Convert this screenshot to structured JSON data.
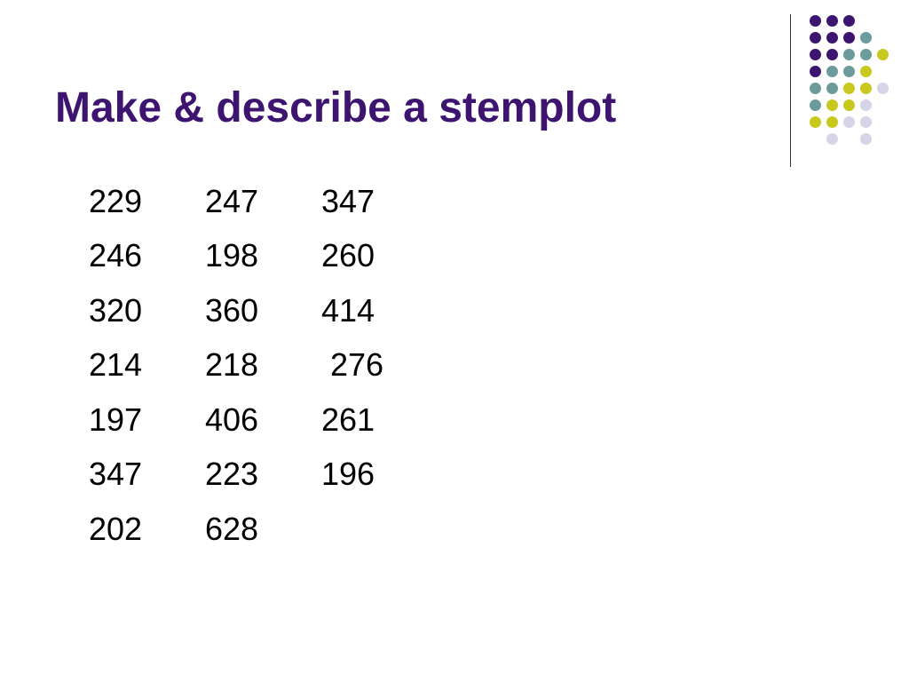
{
  "slide": {
    "title": "Make & describe a stemplot",
    "title_color": "#3d1470",
    "values": [
      [
        "229",
        "247",
        "347"
      ],
      [
        "246",
        "198",
        "260"
      ],
      [
        "320",
        "360",
        "414"
      ],
      [
        "214",
        "218",
        " 276"
      ],
      [
        "197",
        "406",
        "261"
      ],
      [
        "347",
        "223",
        "196"
      ],
      [
        "202",
        "628",
        ""
      ]
    ]
  },
  "decoration": {
    "colors": {
      "purple": "#3d1470",
      "teal": "#6b9b9b",
      "yellow": "#c8c81e",
      "lavender": "#d6d4e6"
    },
    "dots": [
      [
        "purple",
        "purple",
        "purple",
        null,
        null
      ],
      [
        "purple",
        "purple",
        "purple",
        "teal",
        null
      ],
      [
        "purple",
        "purple",
        "teal",
        "teal",
        "yellow"
      ],
      [
        "purple",
        "teal",
        "teal",
        "yellow",
        null
      ],
      [
        "teal",
        "teal",
        "yellow",
        "yellow",
        "lavender"
      ],
      [
        "teal",
        "yellow",
        "yellow",
        "lavender",
        null
      ],
      [
        "yellow",
        "yellow",
        "lavender",
        "lavender",
        null
      ],
      [
        null,
        "lavender",
        null,
        "lavender",
        null
      ]
    ]
  }
}
